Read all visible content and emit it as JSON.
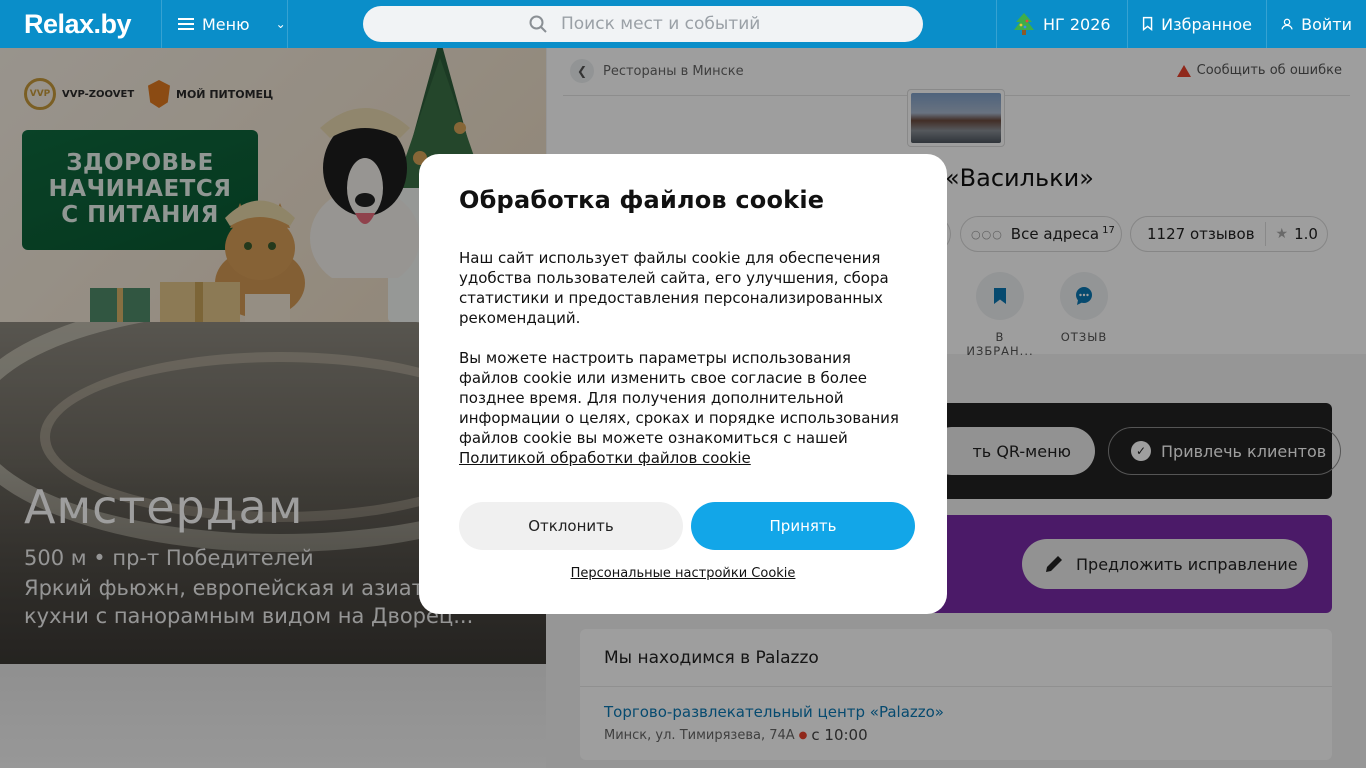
{
  "header": {
    "logo": "Relax.by",
    "menu_label": "Меню",
    "search_placeholder": "Поиск мест и событий",
    "ng_label": "НГ 2026",
    "favorites_label": "Избранное",
    "login_label": "Войти"
  },
  "banner": {
    "brand1": "VVP-ZOOVET",
    "brand2": "МОЙ ПИТОМЕЦ",
    "headline_lines": [
      "ЗДОРОВЬЕ",
      "НАЧИНАЕТСЯ",
      "С ПИТАНИЯ"
    ]
  },
  "promo_card": {
    "title": "Амстердам",
    "subtitle": "500 м • пр-т Победителей",
    "description": "Яркий фьюжн, европейская и азиатская кухни с панорамным видом на Дворец..."
  },
  "place": {
    "breadcrumb": "Рестораны в Минске",
    "report_error": "Сообщить об ошибке",
    "name": "«Васильки»",
    "all_addresses_label": "Все адреса",
    "all_addresses_count": "17",
    "reviews_label": "1127 отзывов",
    "rating": "1.0",
    "actions": {
      "favorite": "В ИЗБРАН...",
      "review": "ОТЗЫВ"
    },
    "qr_menu_label": "ть QR-меню",
    "attract_label": "Привлечь клиентов",
    "suggest_label": "Предложить исправление",
    "location": {
      "heading": "Мы находимся в Palazzo",
      "mall_link": "Торгово-развлекательный центр «Palazzo»",
      "address": "Минск, ул. Тимирязева, 74А",
      "hours": "с 10:00"
    }
  },
  "cookie_modal": {
    "title": "Обработка файлов cookie",
    "paragraph1": "Наш сайт использует файлы cookie для обеспечения удобства пользователей сайта, его улучшения, сбора статистики и предоставления персонализированных рекомендаций.",
    "paragraph2": "Вы можете настроить параметры использования файлов cookie или изменить свое согласие в более позднее время. Для получения дополнительной информации о целях, сроках и порядке использования файлов cookie вы можете ознакомиться с нашей",
    "policy_link": "Политикой обработки файлов cookie",
    "decline_label": "Отклонить",
    "accept_label": "Принять",
    "settings_link": "Персональные настройки Cookie"
  },
  "colors": {
    "header_bg": "#0a8ec9",
    "accept_bg": "#12a6e8",
    "purple_card": "#7a2aa8",
    "dark_card": "#222222"
  }
}
